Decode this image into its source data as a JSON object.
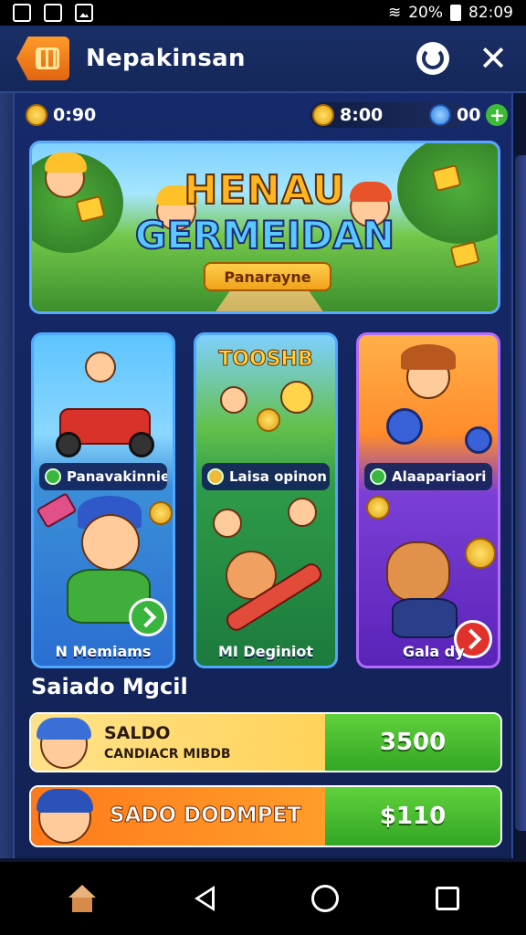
{
  "status_bar": {
    "battery": "20%",
    "time": "82:09"
  },
  "header": {
    "title": "Nepakinsan"
  },
  "currency": {
    "coins": "0:90",
    "gold": "8:00",
    "gems": "00"
  },
  "banner": {
    "title_line1": "HENAU",
    "title_line2": "GERMEIDAN",
    "ribbon": "Panarayne"
  },
  "games": [
    {
      "label": "Panavakinnie",
      "footer": "N Memiams"
    },
    {
      "label": "Laisa opinon",
      "footer": "MI Deginiot",
      "title": "TOOSHB"
    },
    {
      "label": "Alaapariaori",
      "footer": "Gala dy"
    }
  ],
  "saldo_section": {
    "title": "Saiado Mgcil",
    "saldo": {
      "line1": "SALDO",
      "line2": "CANDIACR MIBDB",
      "value": "3500"
    },
    "wallet": {
      "label": "SADO DODMPET",
      "value": "$110"
    }
  },
  "colors": {
    "accent_green": "#39b43c",
    "accent_orange": "#ff8a1f",
    "panel_blue": "#16296a"
  }
}
